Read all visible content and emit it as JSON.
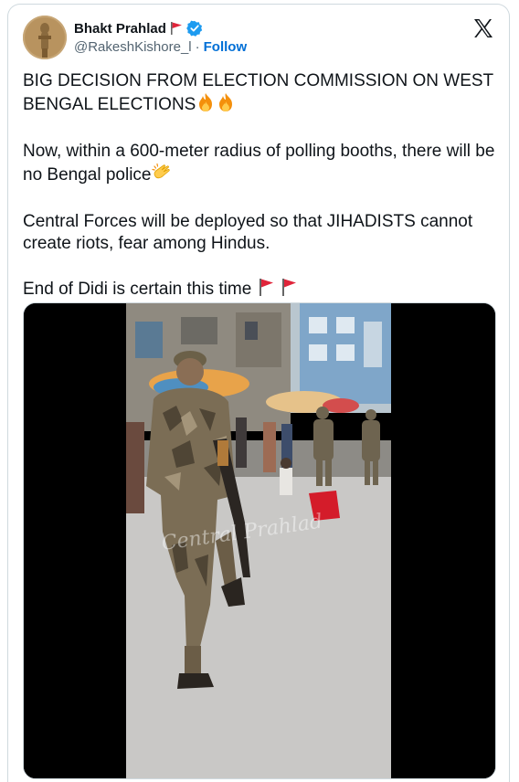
{
  "author": {
    "display_name": "Bhakt Prahlad",
    "handle": "@RakeshKishore_l",
    "separator": "·",
    "follow_label": "Follow",
    "verified": true,
    "name_flag_icon": "red-flag-icon"
  },
  "platform_logo": "x-logo-icon",
  "tweet": {
    "paragraph_1": "BIG DECISION FROM ELECTION COMMISSION ON WEST BENGAL ELECTIONS",
    "paragraph_1_emojis": [
      "fire-icon",
      "fire-icon"
    ],
    "paragraph_2": "Now, within a 600-meter radius of polling booths, there will be no Bengal police",
    "paragraph_2_emojis": [
      "clapping-hands-icon"
    ],
    "paragraph_3": "Central Forces will be deployed so that JIHADISTS cannot create riots, fear among Hindus.",
    "paragraph_4": "End of Didi is certain this time",
    "paragraph_4_emojis": [
      "red-flag-icon",
      "red-flag-icon"
    ]
  },
  "media": {
    "type": "video",
    "watermark_text": "Central Prahlad"
  },
  "colors": {
    "text": "#0f1419",
    "secondary": "#536471",
    "link": "#006fd6",
    "verified": "#1d9bf0",
    "border": "#cfd9de"
  }
}
